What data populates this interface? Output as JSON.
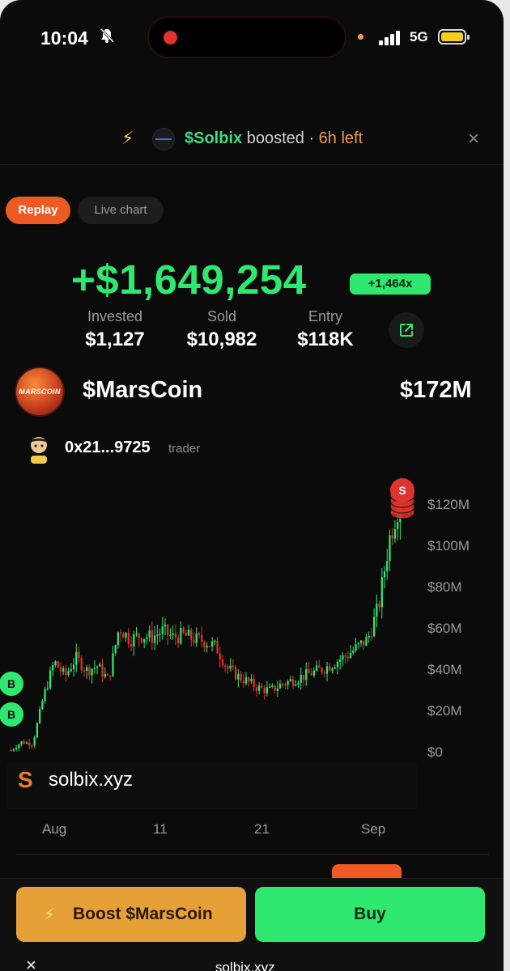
{
  "status_bar": {
    "time": "10:04",
    "network": "5G"
  },
  "banner": {
    "token": "$Solbix",
    "text": "boosted",
    "separator": "·",
    "time_left": "6h left",
    "close": "×"
  },
  "toggle": {
    "replay": "Replay",
    "live": "Live chart"
  },
  "pnl": {
    "profit": "+$1,649,254",
    "multiple": "+1,464x",
    "invested_label": "Invested",
    "invested_value": "$1,127",
    "sold_label": "Sold",
    "sold_value": "$10,982",
    "entry_label": "Entry",
    "entry_value": "$118K"
  },
  "token": {
    "logo_text": "MARSCOIN",
    "name": "$MarsCoin",
    "market_cap": "$172M"
  },
  "trader": {
    "address": "0x21...9725",
    "tag": "trader"
  },
  "chart_data": {
    "type": "line",
    "yticks": [
      "$0",
      "$20M",
      "$40M",
      "$60M",
      "$80M",
      "$100M",
      "$120M"
    ],
    "ylim": [
      0,
      120
    ],
    "xticks": [
      "Aug",
      "11",
      "21",
      "Sep"
    ],
    "markers": [
      {
        "label": "B",
        "type": "buy"
      },
      {
        "label": "B",
        "type": "buy"
      },
      {
        "label": "S",
        "type": "sell"
      }
    ],
    "series": [
      {
        "values": [
          2,
          6,
          5,
          28,
          45,
          38,
          47,
          41,
          43,
          36,
          62,
          56,
          58,
          57,
          60,
          57,
          58,
          56,
          55,
          52,
          42,
          38,
          35,
          32,
          31,
          34,
          36,
          38,
          40,
          42,
          45,
          48,
          52,
          56,
          72,
          105,
          125
        ]
      }
    ]
  },
  "watermark": {
    "logo": "S",
    "site": "solbix.xyz"
  },
  "buttons": {
    "boost_icon": "⚡",
    "boost": "Boost $MarsCoin",
    "buy": "Buy"
  },
  "browser": {
    "close": "×",
    "url": "solbix.xyz"
  },
  "colors": {
    "green": "#2ee86f",
    "red": "#e0322f",
    "orange": "#ee5a24",
    "gold": "#e5a137"
  }
}
